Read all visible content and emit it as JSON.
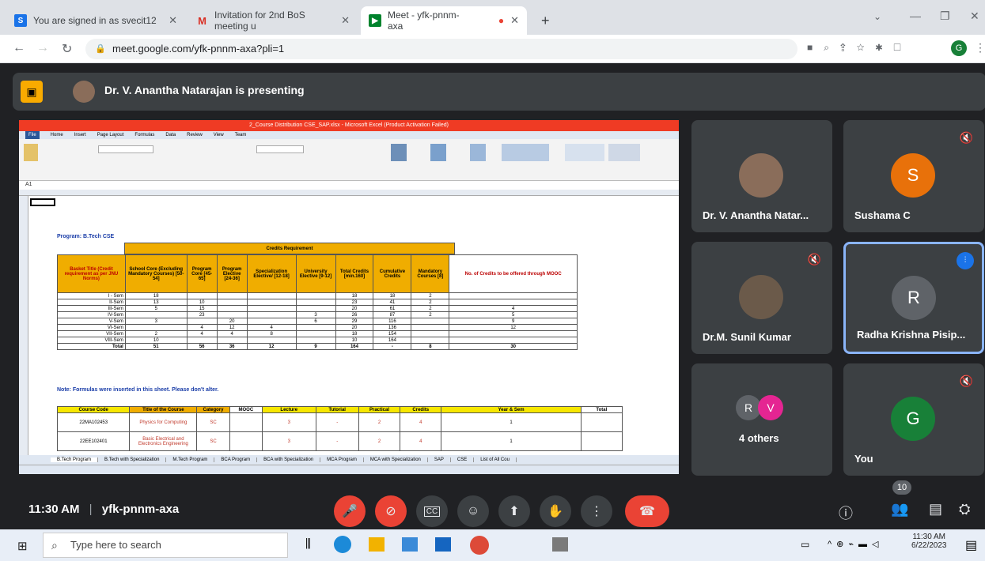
{
  "browser": {
    "tabs": [
      {
        "title": "You are signed in as svecit12",
        "icon": "s-icon",
        "icon_color": "#1a73e8"
      },
      {
        "title": "Invitation for 2nd BoS meeting u",
        "icon": "gmail-icon",
        "icon_color": "#d93025"
      },
      {
        "title": "Meet - yfk-pnnm-axa",
        "icon": "meet-icon",
        "icon_color": "#00832d"
      }
    ],
    "url": "meet.google.com/yfk-pnnm-axa?pli=1"
  },
  "meet": {
    "presenting_text": "Dr. V. Anantha Natarajan is presenting",
    "meeting_code": "yfk-pnnm-axa",
    "time": "11:30 AM",
    "participant_count": "10",
    "participants": [
      {
        "name": "Dr. V. Anantha Natar...",
        "avatar": "photo"
      },
      {
        "name": "Sushama C",
        "avatar": "S",
        "color": "#e8710a"
      },
      {
        "name": "Dr.M. Sunil Kumar",
        "avatar": "photo"
      },
      {
        "name": "Radha Krishna Pisip...",
        "avatar": "R",
        "color": "#5f6368"
      },
      {
        "name": "4 others",
        "avatars": [
          "R",
          "V"
        ]
      },
      {
        "name": "You",
        "avatar": "G",
        "color": "#188038"
      }
    ]
  },
  "excel": {
    "title": "2_Course Distribution CSE_SAP.xlsx - Microsoft Excel (Product Activation Failed)",
    "menu": [
      "File",
      "Home",
      "Insert",
      "Page Layout",
      "Formulas",
      "Data",
      "Review",
      "View",
      "Team"
    ],
    "cell_ref": "A1",
    "program": "Program: B.Tech CSE",
    "credits_header": "Credits Requirement",
    "columns": [
      "Basket Title (Credit requirement as per JNU Norms)",
      "School Core (Excluding Mandatory Courses) [50-54]",
      "Program Core [45-65]",
      "Program Elective [24-36]",
      "Specialization Elective/ [12-18]",
      "University Elective [9-12]",
      "Total Credits [min.160]",
      "Cumulative Credits",
      "Mandatory Courses [8]",
      "No. of Credits to be offered through MOOC"
    ],
    "rows": [
      [
        "I - Sem",
        "18",
        "",
        "",
        "",
        "",
        "18",
        "18",
        "2",
        ""
      ],
      [
        "II-Sem",
        "13",
        "10",
        "",
        "",
        "",
        "23",
        "41",
        "2",
        ""
      ],
      [
        "III-Sem",
        "5",
        "15",
        "",
        "",
        "",
        "20",
        "61",
        "2",
        "4"
      ],
      [
        "IV-Sem",
        "",
        "23",
        "",
        "",
        "3",
        "26",
        "87",
        "2",
        "5"
      ],
      [
        "V-Sem",
        "3",
        "",
        "20",
        "",
        "6",
        "29",
        "116",
        "",
        "9"
      ],
      [
        "VI-Sem",
        "",
        "4",
        "12",
        "4",
        "",
        "20",
        "136",
        "",
        "12"
      ],
      [
        "VII-Sem",
        "2",
        "4",
        "4",
        "8",
        "",
        "18",
        "154",
        "",
        ""
      ],
      [
        "VIII-Sem",
        "10",
        "",
        "",
        "",
        "",
        "10",
        "164",
        "",
        ""
      ],
      [
        "Total",
        "51",
        "56",
        "36",
        "12",
        "9",
        "164",
        "-",
        "8",
        "30"
      ]
    ],
    "note": "Note: Formulas were inserted in this sheet. Please don't alter.",
    "course_cols": [
      "Course Code",
      "Title of the Course",
      "Category",
      "MOOC",
      "Lecture",
      "Tutorial",
      "Practical",
      "Credits",
      "Year & Sem",
      "Total"
    ],
    "courses": [
      [
        "22MA102453",
        "Physics for Computing",
        "SC",
        "",
        "3",
        "-",
        "2",
        "4",
        "1"
      ],
      [
        "22EE102401",
        "Basic Electrical and Electronics Engineering",
        "SC",
        "",
        "3",
        "-",
        "2",
        "4",
        "1"
      ]
    ],
    "sheet_tabs": [
      "B.Tech Program",
      "B.Tech with Specialization",
      "M.Tech Program",
      "BCA Program",
      "BCA with Specialization",
      "MCA Program",
      "MCA with Specialization",
      "SAP",
      "CSE",
      "List of All Cou"
    ]
  },
  "taskbar": {
    "search_placeholder": "Type here to search",
    "time": "11:30 AM",
    "date": "6/22/2023"
  }
}
